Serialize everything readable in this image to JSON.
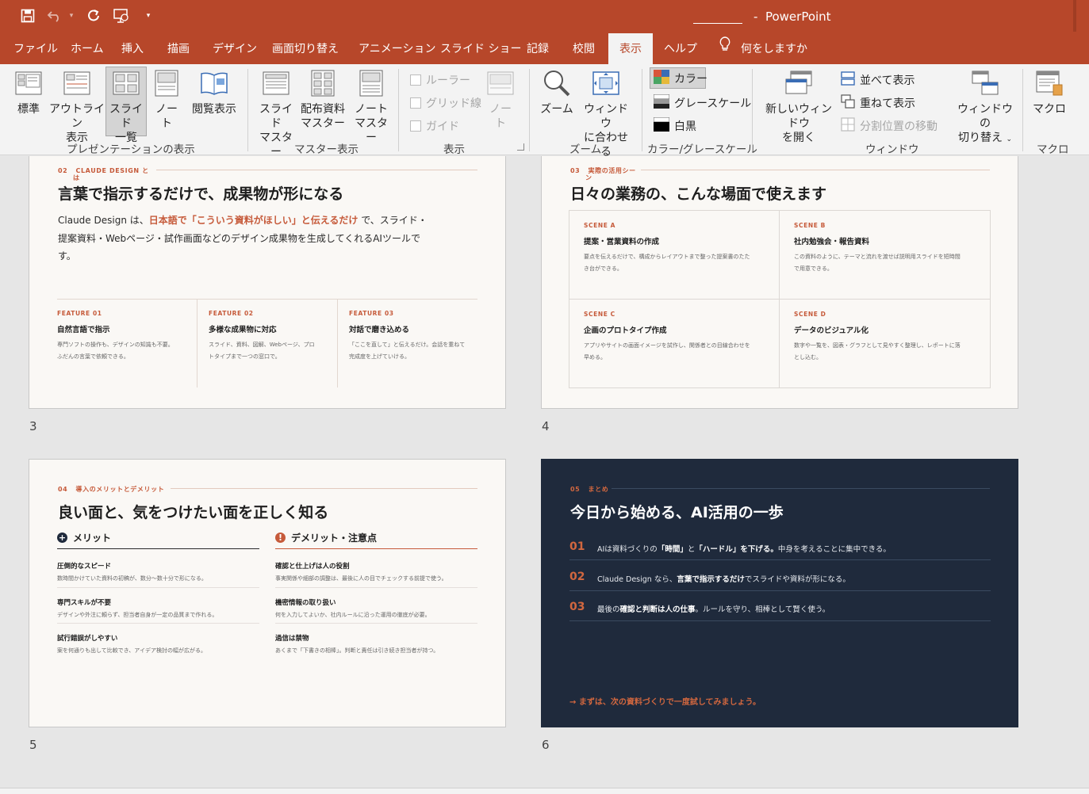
{
  "app": {
    "name": "PowerPoint",
    "separator": "-"
  },
  "colors": {
    "brand": "#b7472a",
    "accent": "#c65a3a",
    "dark_slide": "#1f2a3c"
  },
  "tabs": [
    "ファイル",
    "ホーム",
    "挿入",
    "描画",
    "デザイン",
    "画面切り替え",
    "アニメーション",
    "スライド ショー",
    "記録",
    "校閲",
    "表示",
    "ヘルプ",
    "何をしますか"
  ],
  "active_tab": "表示",
  "ribbon": {
    "presentation_views": {
      "label": "プレゼンテーションの表示",
      "normal": "標準",
      "outline_1": "アウトライン",
      "outline_2": "表示",
      "sorter_1": "スライド",
      "sorter_2": "一覧",
      "notes_1": "ノー",
      "notes_2": "ト",
      "reading": "閲覧表示"
    },
    "master_views": {
      "label": "マスター表示",
      "slide_1": "スライド",
      "slide_2": "マスター",
      "handout_1": "配布資料",
      "handout_2": "マスター",
      "notes_1": "ノート",
      "notes_2": "マスター"
    },
    "show": {
      "label": "表示",
      "ruler": "ルーラー",
      "grid": "グリッド線",
      "guide": "ガイド",
      "notes_1": "ノー",
      "notes_2": "ト"
    },
    "zoom": {
      "label": "ズーム",
      "zoom": "ズーム",
      "fit_1": "ウィンドウ",
      "fit_2": "に合わせる"
    },
    "color": {
      "label": "カラー/グレースケール",
      "color": "カラー",
      "grayscale": "グレースケール",
      "bw": "白黒"
    },
    "window": {
      "label": "ウィンドウ",
      "new_1": "新しいウィンドウ",
      "new_2": "を開く",
      "arrange": "並べて表示",
      "cascade": "重ねて表示",
      "split": "分割位置の移動",
      "switch_1": "ウィンドウの",
      "switch_2": "切り替え"
    },
    "macros": {
      "label": "マクロ",
      "macros": "マクロ"
    }
  },
  "slides": {
    "s3": {
      "number": "3",
      "eyebrow_num": "02",
      "eyebrow_1": "CLAUDE DESIGN と",
      "eyebrow_2": "は",
      "title": "言葉で指示するだけで、成果物が形になる",
      "body_a": "Claude Design は、",
      "body_b": "日本語で「こういう資料がほしい」と伝えるだけ",
      "body_c": " で、スライド・",
      "body_line2": "提案資料・Webページ・試作画面などのデザイン成果物を生成してくれるAIツールで",
      "body_line3": "す。",
      "features": [
        {
          "k": "FEATURE 01",
          "h": "自然言語で指示",
          "d1": "専門ソフトの操作も、デザインの知識も不要。",
          "d2": "ふだんの言葉で依頼できる。"
        },
        {
          "k": "FEATURE 02",
          "h": "多様な成果物に対応",
          "d1": "スライド、資料、図解、Webページ、プロ",
          "d2": "トタイプまで一つの窓口で。"
        },
        {
          "k": "FEATURE 03",
          "h": "対話で磨き込める",
          "d1": "「ここを直して」と伝えるだけ。会話を重ねて",
          "d2": "完成度を上げていける。"
        }
      ]
    },
    "s4": {
      "number": "4",
      "eyebrow_num": "03",
      "eyebrow_1": "実際の活用シー",
      "eyebrow_2": "ン",
      "title": "日々の業務の、こんな場面で使えます",
      "scenes": [
        {
          "k": "SCENE A",
          "h": "提案・営業資料の作成",
          "d1": "要点を伝えるだけで、構成からレイアウトまで整った提案書のたた",
          "d2": "き台ができる。"
        },
        {
          "k": "SCENE B",
          "h": "社内勉強会・報告資料",
          "d1": "この資料のように、テーマと流れを渡せば説明用スライドを短時間",
          "d2": "で用意できる。"
        },
        {
          "k": "SCENE C",
          "h": "企画のプロトタイプ作成",
          "d1": "アプリやサイトの画面イメージを試作し、関係者との目線合わせを",
          "d2": "早める。"
        },
        {
          "k": "SCENE D",
          "h": "データのビジュアル化",
          "d1": "数字や一覧を、図表・グラフとして見やすく整理し、レポートに落",
          "d2": "とし込む。"
        }
      ]
    },
    "s5": {
      "number": "5",
      "eyebrow_num": "04",
      "eyebrow_1": "導入のメリットとデメリット",
      "title": "良い面と、気をつけたい面を正しく知る",
      "merit_title": "メリット",
      "merit_icon": "+",
      "demerit_title": "デメリット・注意点",
      "demerit_icon": "!",
      "merits": [
        {
          "h": "圧倒的なスピード",
          "d": "数時間かけていた資料の初稿が、数分〜数十分で形になる。"
        },
        {
          "h": "専門スキルが不要",
          "d": "デザインや外注に頼らず、担当者自身が一定の品質まで作れる。"
        },
        {
          "h": "試行錯誤がしやすい",
          "d": "案を何通りも出して比較でき、アイデア検討の幅が広がる。"
        }
      ],
      "demerits": [
        {
          "h": "確認と仕上げは人の役割",
          "d": "事実関係や細部の調整は、最後に人の目でチェックする前提で使う。"
        },
        {
          "h": "機密情報の取り扱い",
          "d": "何を入力してよいか、社内ルールに沿った運用の徹底が必要。"
        },
        {
          "h": "過信は禁物",
          "d": "あくまで「下書きの相棒」。判断と責任は引き続き担当者が持つ。"
        }
      ]
    },
    "s6": {
      "number": "6",
      "eyebrow_num": "05",
      "eyebrow_1": "まとめ",
      "title": "今日から始める、AI活用の一歩",
      "steps": [
        {
          "n": "01",
          "a": "AIは資料づくりの",
          "b": "「時間」",
          "c": "と",
          "d": "「ハードル」を下げる。",
          "e": "中身を考えることに集中できる。"
        },
        {
          "n": "02",
          "a": "Claude Design なら、",
          "b": "言葉で指示するだけ",
          "c": "でスライドや資料が形になる。",
          "d": "",
          "e": ""
        },
        {
          "n": "03",
          "a": "最後の",
          "b": "確認と判断は人の仕事",
          "c": "。ルールを守り、相棒として賢く使う。",
          "d": "",
          "e": ""
        }
      ],
      "cta": "→  まずは、次の資料づくりで一度試してみましょう。"
    }
  }
}
